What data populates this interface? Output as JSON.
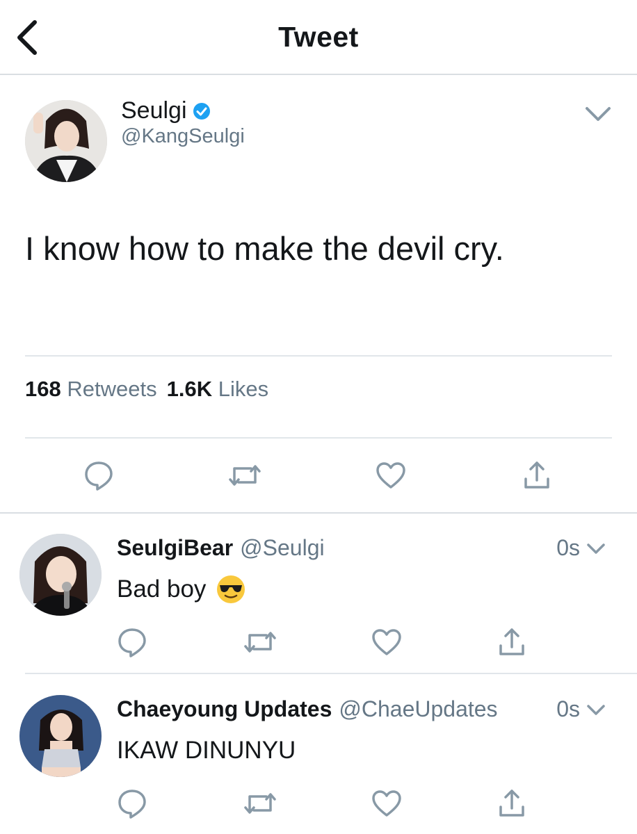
{
  "header": {
    "title": "Tweet",
    "back_icon": "chevron-left-icon"
  },
  "tweet": {
    "author_name": "Seulgi",
    "author_handle": "@KangSeulgi",
    "verified": true,
    "text": "I know how to make the devil cry.",
    "retweets_count": "168",
    "retweets_label": "Retweets",
    "likes_count": "1.6K",
    "likes_label": "Likes"
  },
  "replies": [
    {
      "name": "SeulgiBear",
      "handle": "@Seulgi",
      "time": "0s",
      "text": "Bad boy",
      "emoji": "smiling-face-with-sunglasses"
    },
    {
      "name": "Chaeyoung Updates",
      "handle": "@ChaeUpdates",
      "time": "0s",
      "text": "IKAW DINUNYU"
    }
  ],
  "colors": {
    "text": "#14171a",
    "secondary": "#657786",
    "verified": "#1da1f2",
    "divider": "#e1e6ea"
  }
}
